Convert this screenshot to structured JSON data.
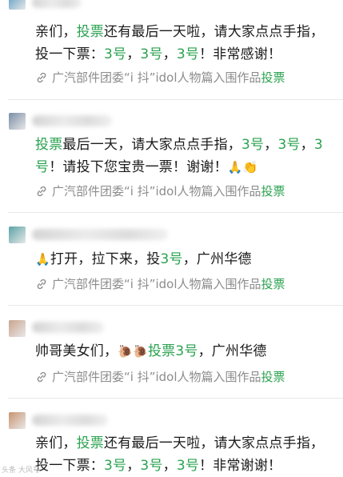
{
  "posts": [
    {
      "content": [
        {
          "t": "亲们，"
        },
        {
          "t": "投票",
          "hl": true
        },
        {
          "t": "还有最后一天啦，请大家点点手指，投一下票："
        },
        {
          "t": "3号",
          "hl": true
        },
        {
          "t": "，"
        },
        {
          "t": "3号",
          "hl": true
        },
        {
          "t": "，"
        },
        {
          "t": "3号",
          "hl": true
        },
        {
          "t": "！非常感谢！"
        }
      ],
      "link_text": "广汽部件团委“i 抖”idol人物篇入围作品",
      "link_vote": "投票",
      "avatar_color": "#6fa8c9"
    },
    {
      "content": [
        {
          "t": "投票",
          "hl": true
        },
        {
          "t": "最后一天，请大家点点手指，"
        },
        {
          "t": "3号",
          "hl": true
        },
        {
          "t": "，"
        },
        {
          "t": "3号",
          "hl": true
        },
        {
          "t": "，"
        },
        {
          "t": "3号",
          "hl": true
        },
        {
          "t": "！请投下您宝贵一票！谢谢！"
        },
        {
          "t": "🙏👏",
          "emoji": true
        }
      ],
      "link_text": "广汽部件团委“i 抖”idol人物篇入围作品",
      "link_vote": "投票",
      "avatar_color": "#7a8ea6"
    },
    {
      "content": [
        {
          "t": "🙏",
          "emoji": true
        },
        {
          "t": "打开，拉下来，投"
        },
        {
          "t": "3号",
          "hl": true
        },
        {
          "t": "，广州华德"
        }
      ],
      "link_text": "广汽部件团委“i 抖”idol人物篇入围作品",
      "link_vote": "投票",
      "avatar_color": "#5aa3a6"
    },
    {
      "content": [
        {
          "t": "帅哥美女们，"
        },
        {
          "t": "🐌🐌",
          "emoji": true
        },
        {
          "t": "投票3号",
          "hl": true
        },
        {
          "t": "，广州华德"
        }
      ],
      "link_text": "广汽部件团委“i 抖”idol人物篇入围作品",
      "link_vote": "投票",
      "avatar_color": "#caa48e"
    },
    {
      "content": [
        {
          "t": "亲们，"
        },
        {
          "t": "投票",
          "hl": true
        },
        {
          "t": "还有最后一天啦，请大家点点手指，投一下票："
        },
        {
          "t": "3号",
          "hl": true
        },
        {
          "t": "，"
        },
        {
          "t": "3号",
          "hl": true
        },
        {
          "t": "，"
        },
        {
          "t": "3号",
          "hl": true
        },
        {
          "t": "！非常谢谢！"
        }
      ],
      "avatar_color": "#c99470"
    }
  ],
  "watermark": "头条 大风号",
  "colors": {
    "highlight": "#2aa24f",
    "meta": "#8c8c8c",
    "divider": "#e9e9e9"
  },
  "icons": {
    "link": "link-icon"
  }
}
